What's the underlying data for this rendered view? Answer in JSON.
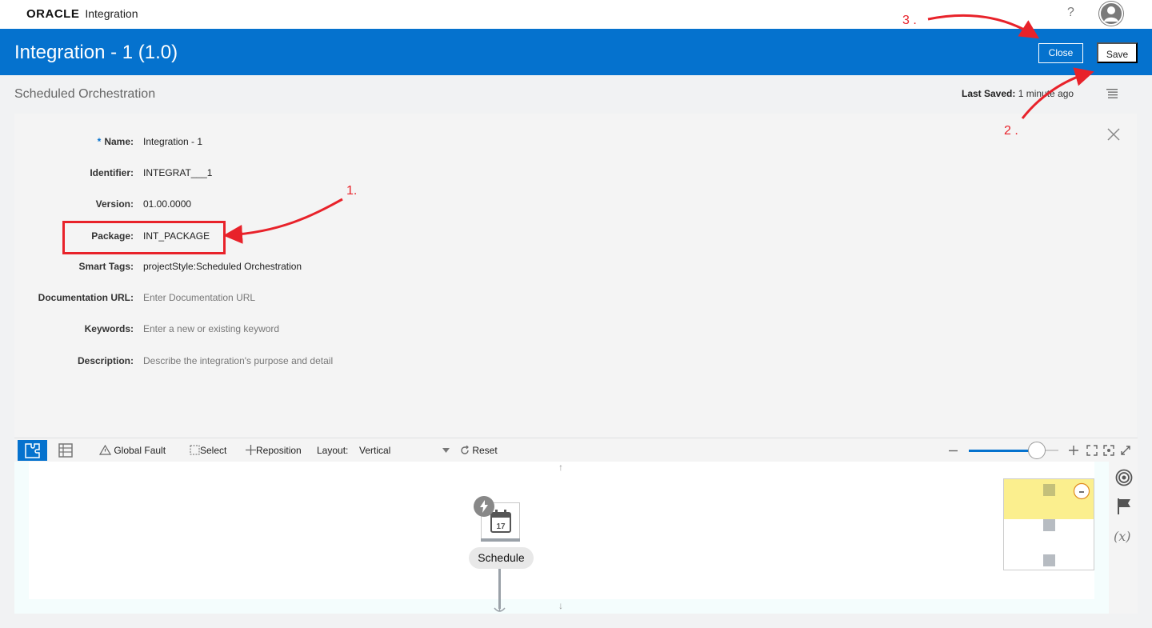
{
  "app": {
    "brand": "ORACLE",
    "product": "Integration",
    "help_label": "?"
  },
  "header": {
    "title": "Integration - 1 (1.0)",
    "close_label": "Close",
    "save_label": "Save"
  },
  "subheader": {
    "title": "Scheduled Orchestration",
    "last_saved_label": "Last Saved:",
    "last_saved_value": "1 minute ago"
  },
  "form": {
    "required_mark": "*",
    "fields": [
      {
        "label": "Name:",
        "value": "Integration - 1",
        "placeholder": false
      },
      {
        "label": "Identifier:",
        "value": "INTEGRAT___1",
        "placeholder": false
      },
      {
        "label": "Version:",
        "value": "01.00.0000",
        "placeholder": false
      },
      {
        "label": "Package:",
        "value": "INT_PACKAGE",
        "placeholder": false
      },
      {
        "label": "Smart Tags:",
        "value": "projectStyle:Scheduled Orchestration",
        "placeholder": false
      },
      {
        "label": "Documentation URL:",
        "value": "Enter Documentation URL",
        "placeholder": true
      },
      {
        "label": "Keywords:",
        "value": "Enter a new or existing keyword",
        "placeholder": true
      },
      {
        "label": "Description:",
        "value": "Describe the integration's purpose and detail",
        "placeholder": true
      }
    ]
  },
  "toolbar": {
    "global_fault": "Global Fault",
    "select": "Select",
    "reposition": "Reposition",
    "layout_label": "Layout:",
    "layout_value": "Vertical",
    "reset": "Reset"
  },
  "canvas": {
    "node_label": "Schedule",
    "calendar_day": "17",
    "variables_label": "(x)"
  },
  "annotations": {
    "step1": "1.",
    "step2": "2 .",
    "step3": "3 ."
  },
  "colors": {
    "brand_blue": "#0572ce",
    "annotation_red": "#e8222a",
    "minimap_highlight": "#fbef8e"
  }
}
